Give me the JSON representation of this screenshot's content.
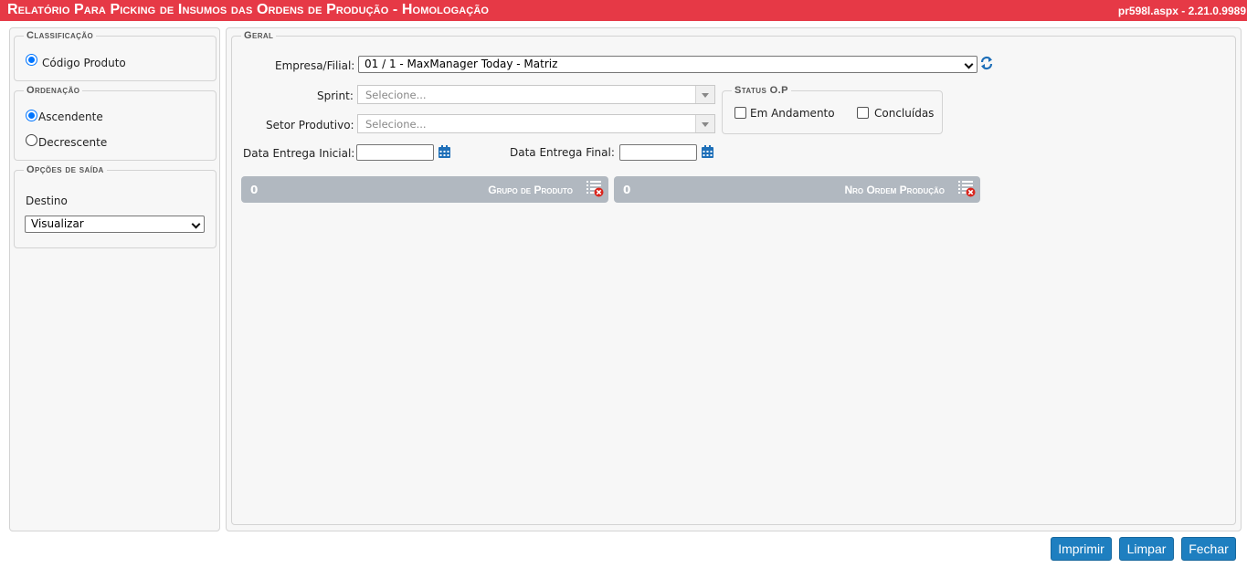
{
  "header": {
    "title": "Relatório Para Picking de Insumos das Ordens de Produção  - Homologação",
    "version": "pr598l.aspx - 2.21.0.9989",
    "color": "#e63946"
  },
  "sidebar": {
    "classificacao": {
      "legend": "Classificação",
      "options": [
        {
          "label": "Código Produto",
          "checked": true
        }
      ]
    },
    "ordenacao": {
      "legend": "Ordenação",
      "options": [
        {
          "label": "Ascendente",
          "checked": true
        },
        {
          "label": "Decrescente",
          "checked": false
        }
      ]
    },
    "opcoes_saida": {
      "legend": "Opções de saída",
      "destino_label": "Destino",
      "destino_value": "Visualizar"
    }
  },
  "main": {
    "legend": "Geral",
    "empresa_label": "Empresa/Filial:",
    "empresa_value": "01 / 1 - MaxManager Today - Matriz",
    "sprint_label": "Sprint:",
    "sprint_placeholder": "Selecione...",
    "setor_label": "Setor Produtivo:",
    "setor_placeholder": "Selecione...",
    "status": {
      "legend": "Status O.P",
      "em_andamento": "Em Andamento",
      "concluidas": "Concluídas"
    },
    "data_inicial_label": "Data Entrega Inicial:",
    "data_final_label": "Data Entrega Final:",
    "filters": [
      {
        "count": "0",
        "label": "Grupo de Produto"
      },
      {
        "count": "0",
        "label": "Nro Ordem Produção"
      }
    ]
  },
  "footer": {
    "imprimir": "Imprimir",
    "limpar": "Limpar",
    "fechar": "Fechar",
    "button_color": "#1e7fc0"
  }
}
